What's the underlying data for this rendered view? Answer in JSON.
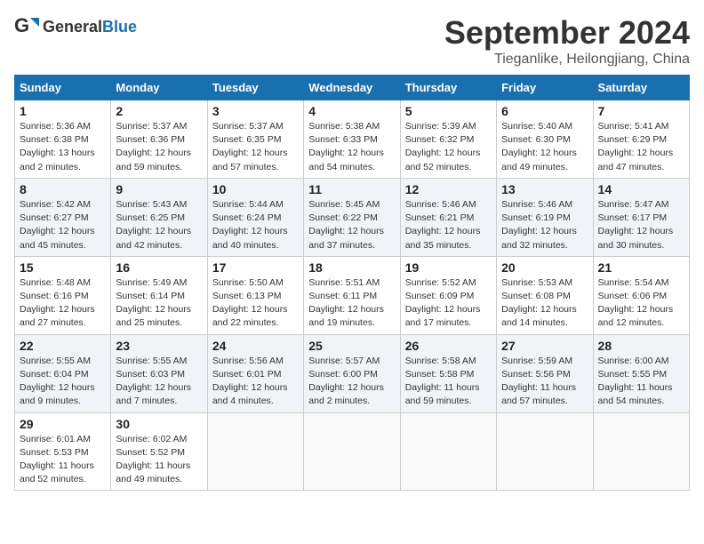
{
  "logo": {
    "general": "General",
    "blue": "Blue"
  },
  "title": "September 2024",
  "location": "Tieganlike, Heilongjiang, China",
  "weekdays": [
    "Sunday",
    "Monday",
    "Tuesday",
    "Wednesday",
    "Thursday",
    "Friday",
    "Saturday"
  ],
  "weeks": [
    [
      {
        "day": "1",
        "info": "Sunrise: 5:36 AM\nSunset: 6:38 PM\nDaylight: 13 hours\nand 2 minutes."
      },
      {
        "day": "2",
        "info": "Sunrise: 5:37 AM\nSunset: 6:36 PM\nDaylight: 12 hours\nand 59 minutes."
      },
      {
        "day": "3",
        "info": "Sunrise: 5:37 AM\nSunset: 6:35 PM\nDaylight: 12 hours\nand 57 minutes."
      },
      {
        "day": "4",
        "info": "Sunrise: 5:38 AM\nSunset: 6:33 PM\nDaylight: 12 hours\nand 54 minutes."
      },
      {
        "day": "5",
        "info": "Sunrise: 5:39 AM\nSunset: 6:32 PM\nDaylight: 12 hours\nand 52 minutes."
      },
      {
        "day": "6",
        "info": "Sunrise: 5:40 AM\nSunset: 6:30 PM\nDaylight: 12 hours\nand 49 minutes."
      },
      {
        "day": "7",
        "info": "Sunrise: 5:41 AM\nSunset: 6:29 PM\nDaylight: 12 hours\nand 47 minutes."
      }
    ],
    [
      {
        "day": "8",
        "info": "Sunrise: 5:42 AM\nSunset: 6:27 PM\nDaylight: 12 hours\nand 45 minutes."
      },
      {
        "day": "9",
        "info": "Sunrise: 5:43 AM\nSunset: 6:25 PM\nDaylight: 12 hours\nand 42 minutes."
      },
      {
        "day": "10",
        "info": "Sunrise: 5:44 AM\nSunset: 6:24 PM\nDaylight: 12 hours\nand 40 minutes."
      },
      {
        "day": "11",
        "info": "Sunrise: 5:45 AM\nSunset: 6:22 PM\nDaylight: 12 hours\nand 37 minutes."
      },
      {
        "day": "12",
        "info": "Sunrise: 5:46 AM\nSunset: 6:21 PM\nDaylight: 12 hours\nand 35 minutes."
      },
      {
        "day": "13",
        "info": "Sunrise: 5:46 AM\nSunset: 6:19 PM\nDaylight: 12 hours\nand 32 minutes."
      },
      {
        "day": "14",
        "info": "Sunrise: 5:47 AM\nSunset: 6:17 PM\nDaylight: 12 hours\nand 30 minutes."
      }
    ],
    [
      {
        "day": "15",
        "info": "Sunrise: 5:48 AM\nSunset: 6:16 PM\nDaylight: 12 hours\nand 27 minutes."
      },
      {
        "day": "16",
        "info": "Sunrise: 5:49 AM\nSunset: 6:14 PM\nDaylight: 12 hours\nand 25 minutes."
      },
      {
        "day": "17",
        "info": "Sunrise: 5:50 AM\nSunset: 6:13 PM\nDaylight: 12 hours\nand 22 minutes."
      },
      {
        "day": "18",
        "info": "Sunrise: 5:51 AM\nSunset: 6:11 PM\nDaylight: 12 hours\nand 19 minutes."
      },
      {
        "day": "19",
        "info": "Sunrise: 5:52 AM\nSunset: 6:09 PM\nDaylight: 12 hours\nand 17 minutes."
      },
      {
        "day": "20",
        "info": "Sunrise: 5:53 AM\nSunset: 6:08 PM\nDaylight: 12 hours\nand 14 minutes."
      },
      {
        "day": "21",
        "info": "Sunrise: 5:54 AM\nSunset: 6:06 PM\nDaylight: 12 hours\nand 12 minutes."
      }
    ],
    [
      {
        "day": "22",
        "info": "Sunrise: 5:55 AM\nSunset: 6:04 PM\nDaylight: 12 hours\nand 9 minutes."
      },
      {
        "day": "23",
        "info": "Sunrise: 5:55 AM\nSunset: 6:03 PM\nDaylight: 12 hours\nand 7 minutes."
      },
      {
        "day": "24",
        "info": "Sunrise: 5:56 AM\nSunset: 6:01 PM\nDaylight: 12 hours\nand 4 minutes."
      },
      {
        "day": "25",
        "info": "Sunrise: 5:57 AM\nSunset: 6:00 PM\nDaylight: 12 hours\nand 2 minutes."
      },
      {
        "day": "26",
        "info": "Sunrise: 5:58 AM\nSunset: 5:58 PM\nDaylight: 11 hours\nand 59 minutes."
      },
      {
        "day": "27",
        "info": "Sunrise: 5:59 AM\nSunset: 5:56 PM\nDaylight: 11 hours\nand 57 minutes."
      },
      {
        "day": "28",
        "info": "Sunrise: 6:00 AM\nSunset: 5:55 PM\nDaylight: 11 hours\nand 54 minutes."
      }
    ],
    [
      {
        "day": "29",
        "info": "Sunrise: 6:01 AM\nSunset: 5:53 PM\nDaylight: 11 hours\nand 52 minutes."
      },
      {
        "day": "30",
        "info": "Sunrise: 6:02 AM\nSunset: 5:52 PM\nDaylight: 11 hours\nand 49 minutes."
      },
      {
        "day": "",
        "info": ""
      },
      {
        "day": "",
        "info": ""
      },
      {
        "day": "",
        "info": ""
      },
      {
        "day": "",
        "info": ""
      },
      {
        "day": "",
        "info": ""
      }
    ]
  ]
}
